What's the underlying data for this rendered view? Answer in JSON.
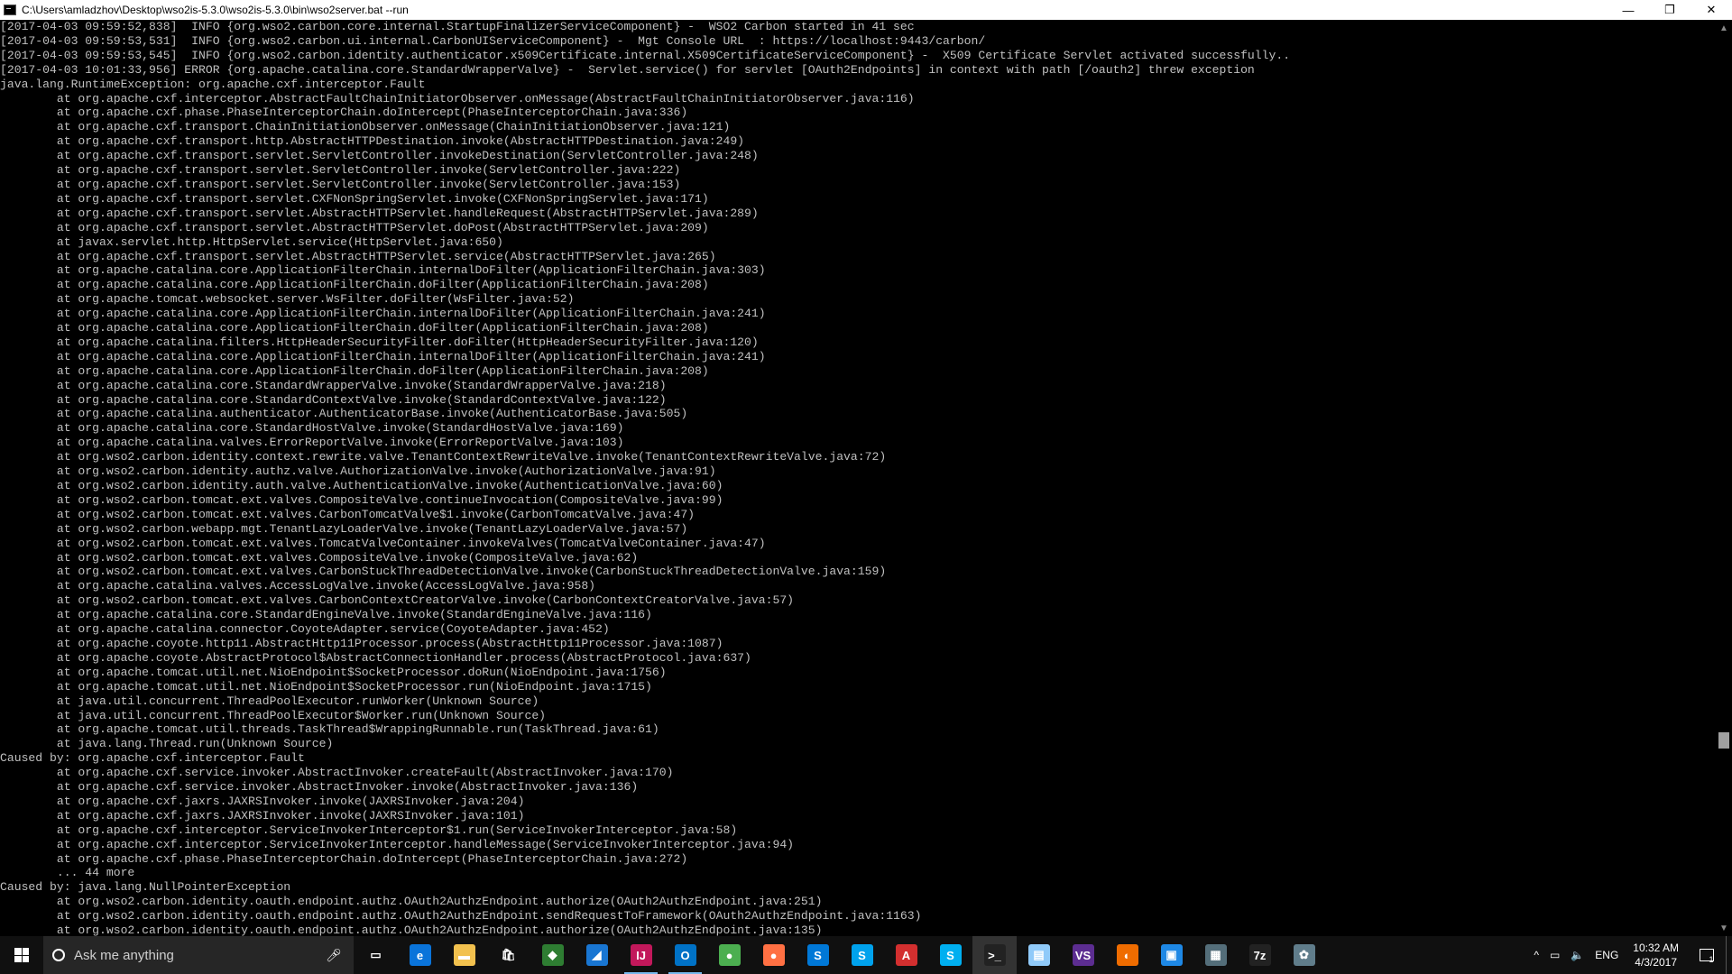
{
  "window": {
    "title": "C:\\Users\\amladzhov\\Desktop\\wso2is-5.3.0\\wso2is-5.3.0\\bin\\wso2server.bat  --run",
    "minimize": "—",
    "maximize": "❐",
    "close": "✕"
  },
  "terminal": {
    "lines": [
      "[2017-04-03 09:59:52,838]  INFO {org.wso2.carbon.core.internal.StartupFinalizerServiceComponent} -  WSO2 Carbon started in 41 sec",
      "[2017-04-03 09:59:53,531]  INFO {org.wso2.carbon.ui.internal.CarbonUIServiceComponent} -  Mgt Console URL  : https://localhost:9443/carbon/",
      "[2017-04-03 09:59:53,545]  INFO {org.wso2.carbon.identity.authenticator.x509Certificate.internal.X509CertificateServiceComponent} -  X509 Certificate Servlet activated successfully..",
      "[2017-04-03 10:01:33,956] ERROR {org.apache.catalina.core.StandardWrapperValve} -  Servlet.service() for servlet [OAuth2Endpoints] in context with path [/oauth2] threw exception",
      "java.lang.RuntimeException: org.apache.cxf.interceptor.Fault",
      "        at org.apache.cxf.interceptor.AbstractFaultChainInitiatorObserver.onMessage(AbstractFaultChainInitiatorObserver.java:116)",
      "        at org.apache.cxf.phase.PhaseInterceptorChain.doIntercept(PhaseInterceptorChain.java:336)",
      "        at org.apache.cxf.transport.ChainInitiationObserver.onMessage(ChainInitiationObserver.java:121)",
      "        at org.apache.cxf.transport.http.AbstractHTTPDestination.invoke(AbstractHTTPDestination.java:249)",
      "        at org.apache.cxf.transport.servlet.ServletController.invokeDestination(ServletController.java:248)",
      "        at org.apache.cxf.transport.servlet.ServletController.invoke(ServletController.java:222)",
      "        at org.apache.cxf.transport.servlet.ServletController.invoke(ServletController.java:153)",
      "        at org.apache.cxf.transport.servlet.CXFNonSpringServlet.invoke(CXFNonSpringServlet.java:171)",
      "        at org.apache.cxf.transport.servlet.AbstractHTTPServlet.handleRequest(AbstractHTTPServlet.java:289)",
      "        at org.apache.cxf.transport.servlet.AbstractHTTPServlet.doPost(AbstractHTTPServlet.java:209)",
      "        at javax.servlet.http.HttpServlet.service(HttpServlet.java:650)",
      "        at org.apache.cxf.transport.servlet.AbstractHTTPServlet.service(AbstractHTTPServlet.java:265)",
      "        at org.apache.catalina.core.ApplicationFilterChain.internalDoFilter(ApplicationFilterChain.java:303)",
      "        at org.apache.catalina.core.ApplicationFilterChain.doFilter(ApplicationFilterChain.java:208)",
      "        at org.apache.tomcat.websocket.server.WsFilter.doFilter(WsFilter.java:52)",
      "        at org.apache.catalina.core.ApplicationFilterChain.internalDoFilter(ApplicationFilterChain.java:241)",
      "        at org.apache.catalina.core.ApplicationFilterChain.doFilter(ApplicationFilterChain.java:208)",
      "        at org.apache.catalina.filters.HttpHeaderSecurityFilter.doFilter(HttpHeaderSecurityFilter.java:120)",
      "        at org.apache.catalina.core.ApplicationFilterChain.internalDoFilter(ApplicationFilterChain.java:241)",
      "        at org.apache.catalina.core.ApplicationFilterChain.doFilter(ApplicationFilterChain.java:208)",
      "        at org.apache.catalina.core.StandardWrapperValve.invoke(StandardWrapperValve.java:218)",
      "        at org.apache.catalina.core.StandardContextValve.invoke(StandardContextValve.java:122)",
      "        at org.apache.catalina.authenticator.AuthenticatorBase.invoke(AuthenticatorBase.java:505)",
      "        at org.apache.catalina.core.StandardHostValve.invoke(StandardHostValve.java:169)",
      "        at org.apache.catalina.valves.ErrorReportValve.invoke(ErrorReportValve.java:103)",
      "        at org.wso2.carbon.identity.context.rewrite.valve.TenantContextRewriteValve.invoke(TenantContextRewriteValve.java:72)",
      "        at org.wso2.carbon.identity.authz.valve.AuthorizationValve.invoke(AuthorizationValve.java:91)",
      "        at org.wso2.carbon.identity.auth.valve.AuthenticationValve.invoke(AuthenticationValve.java:60)",
      "        at org.wso2.carbon.tomcat.ext.valves.CompositeValve.continueInvocation(CompositeValve.java:99)",
      "        at org.wso2.carbon.tomcat.ext.valves.CarbonTomcatValve$1.invoke(CarbonTomcatValve.java:47)",
      "        at org.wso2.carbon.webapp.mgt.TenantLazyLoaderValve.invoke(TenantLazyLoaderValve.java:57)",
      "        at org.wso2.carbon.tomcat.ext.valves.TomcatValveContainer.invokeValves(TomcatValveContainer.java:47)",
      "        at org.wso2.carbon.tomcat.ext.valves.CompositeValve.invoke(CompositeValve.java:62)",
      "        at org.wso2.carbon.tomcat.ext.valves.CarbonStuckThreadDetectionValve.invoke(CarbonStuckThreadDetectionValve.java:159)",
      "        at org.apache.catalina.valves.AccessLogValve.invoke(AccessLogValve.java:958)",
      "        at org.wso2.carbon.tomcat.ext.valves.CarbonContextCreatorValve.invoke(CarbonContextCreatorValve.java:57)",
      "        at org.apache.catalina.core.StandardEngineValve.invoke(StandardEngineValve.java:116)",
      "        at org.apache.catalina.connector.CoyoteAdapter.service(CoyoteAdapter.java:452)",
      "        at org.apache.coyote.http11.AbstractHttp11Processor.process(AbstractHttp11Processor.java:1087)",
      "        at org.apache.coyote.AbstractProtocol$AbstractConnectionHandler.process(AbstractProtocol.java:637)",
      "        at org.apache.tomcat.util.net.NioEndpoint$SocketProcessor.doRun(NioEndpoint.java:1756)",
      "        at org.apache.tomcat.util.net.NioEndpoint$SocketProcessor.run(NioEndpoint.java:1715)",
      "        at java.util.concurrent.ThreadPoolExecutor.runWorker(Unknown Source)",
      "        at java.util.concurrent.ThreadPoolExecutor$Worker.run(Unknown Source)",
      "        at org.apache.tomcat.util.threads.TaskThread$WrappingRunnable.run(TaskThread.java:61)",
      "        at java.lang.Thread.run(Unknown Source)",
      "Caused by: org.apache.cxf.interceptor.Fault",
      "        at org.apache.cxf.service.invoker.AbstractInvoker.createFault(AbstractInvoker.java:170)",
      "        at org.apache.cxf.service.invoker.AbstractInvoker.invoke(AbstractInvoker.java:136)",
      "        at org.apache.cxf.jaxrs.JAXRSInvoker.invoke(JAXRSInvoker.java:204)",
      "        at org.apache.cxf.jaxrs.JAXRSInvoker.invoke(JAXRSInvoker.java:101)",
      "        at org.apache.cxf.interceptor.ServiceInvokerInterceptor$1.run(ServiceInvokerInterceptor.java:58)",
      "        at org.apache.cxf.interceptor.ServiceInvokerInterceptor.handleMessage(ServiceInvokerInterceptor.java:94)",
      "        at org.apache.cxf.phase.PhaseInterceptorChain.doIntercept(PhaseInterceptorChain.java:272)",
      "        ... 44 more",
      "Caused by: java.lang.NullPointerException",
      "        at org.wso2.carbon.identity.oauth.endpoint.authz.OAuth2AuthzEndpoint.authorize(OAuth2AuthzEndpoint.java:251)",
      "        at org.wso2.carbon.identity.oauth.endpoint.authz.OAuth2AuthzEndpoint.sendRequestToFramework(OAuth2AuthzEndpoint.java:1163)",
      "        at org.wso2.carbon.identity.oauth.endpoint.authz.OAuth2AuthzEndpoint.authorize(OAuth2AuthzEndpoint.java:135)"
    ]
  },
  "taskbar": {
    "search_placeholder": "Ask me anything",
    "apps": [
      {
        "name": "task-view-icon",
        "glyph": "▭",
        "color": "#101010",
        "state": ""
      },
      {
        "name": "edge-icon",
        "glyph": "e",
        "color": "#0a74da",
        "state": ""
      },
      {
        "name": "file-explorer-icon",
        "glyph": "▬",
        "color": "#f2c14e",
        "state": ""
      },
      {
        "name": "store-icon",
        "glyph": "🛍",
        "color": "#101010",
        "state": ""
      },
      {
        "name": "app-diamond-icon",
        "glyph": "◆",
        "color": "#2e7d32",
        "state": ""
      },
      {
        "name": "app-blue-icon",
        "glyph": "◢",
        "color": "#1976d2",
        "state": ""
      },
      {
        "name": "intellij-icon",
        "glyph": "IJ",
        "color": "#c2185b",
        "state": "running"
      },
      {
        "name": "outlook-icon",
        "glyph": "O",
        "color": "#0072c6",
        "state": "running"
      },
      {
        "name": "chrome-icon",
        "glyph": "●",
        "color": "#4caf50",
        "state": ""
      },
      {
        "name": "firefox-icon",
        "glyph": "●",
        "color": "#ff7043",
        "state": ""
      },
      {
        "name": "skype-business-icon",
        "glyph": "S",
        "color": "#0078d7",
        "state": ""
      },
      {
        "name": "app-lync-icon",
        "glyph": "S",
        "color": "#00a2ed",
        "state": ""
      },
      {
        "name": "pdf-icon",
        "glyph": "A",
        "color": "#d32f2f",
        "state": ""
      },
      {
        "name": "skype-icon",
        "glyph": "S",
        "color": "#00aff0",
        "state": ""
      },
      {
        "name": "cmd-icon",
        "glyph": ">_",
        "color": "#222222",
        "state": "active"
      },
      {
        "name": "notepad-icon",
        "glyph": "▤",
        "color": "#90caf9",
        "state": ""
      },
      {
        "name": "visual-studio-icon",
        "glyph": "VS",
        "color": "#5c2d91",
        "state": ""
      },
      {
        "name": "app-orange-icon",
        "glyph": "◐",
        "color": "#ef6c00",
        "state": ""
      },
      {
        "name": "app-network-icon",
        "glyph": "▣",
        "color": "#1e88e5",
        "state": ""
      },
      {
        "name": "app-remote-icon",
        "glyph": "▦",
        "color": "#546e7a",
        "state": ""
      },
      {
        "name": "7zip-icon",
        "glyph": "7z",
        "color": "#222222",
        "state": ""
      },
      {
        "name": "app-gear-icon",
        "glyph": "✿",
        "color": "#607d8b",
        "state": ""
      }
    ],
    "tray": {
      "chevron": "^",
      "network": "▭",
      "volume": "🔈",
      "language": "ENG",
      "time": "10:32 AM",
      "date": "4/3/2017",
      "notifications_count": "1"
    }
  }
}
